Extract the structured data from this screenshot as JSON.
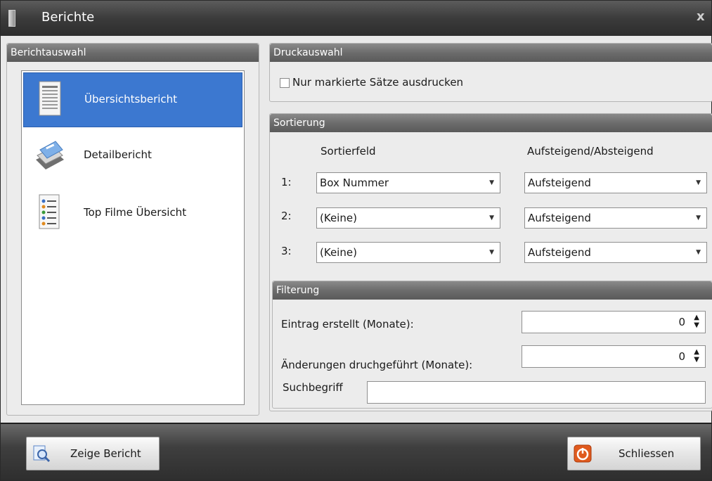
{
  "window": {
    "title": "Berichte",
    "close_label": "x"
  },
  "berichtauswahl": {
    "header": "Berichtauswahl",
    "items": [
      {
        "label": "Übersichtsbericht",
        "selected": true,
        "icon": "document-list-icon"
      },
      {
        "label": "Detailbericht",
        "selected": false,
        "icon": "stacked-pages-icon"
      },
      {
        "label": "Top  Filme Übersicht",
        "selected": false,
        "icon": "checklist-icon"
      }
    ]
  },
  "druckauswahl": {
    "header": "Druckauswahl",
    "checkbox_label": "Nur markierte Sätze ausdrucken",
    "checked": false
  },
  "sortierung": {
    "header": "Sortierung",
    "col_field": "Sortierfeld",
    "col_order": "Aufsteigend/Absteigend",
    "rows": [
      {
        "num": "1:",
        "field": "Box Nummer",
        "order": "Aufsteigend"
      },
      {
        "num": "2:",
        "field": "(Keine)",
        "order": "Aufsteigend"
      },
      {
        "num": "3:",
        "field": "(Keine)",
        "order": "Aufsteigend"
      }
    ]
  },
  "filterung": {
    "header": "Filterung",
    "created_label": "Eintrag erstellt (Monate):",
    "created_value": "0",
    "changed_label": "Änderungen druchgeführt (Monate):",
    "changed_value": "0",
    "search_label": "Suchbegriff",
    "search_value": ""
  },
  "buttons": {
    "show_report": "Zeige Bericht",
    "close": "Schliessen"
  },
  "colors": {
    "selection": "#3c78d0",
    "header_gray": "#6c6c6c",
    "close_icon": "#e05a1e"
  }
}
